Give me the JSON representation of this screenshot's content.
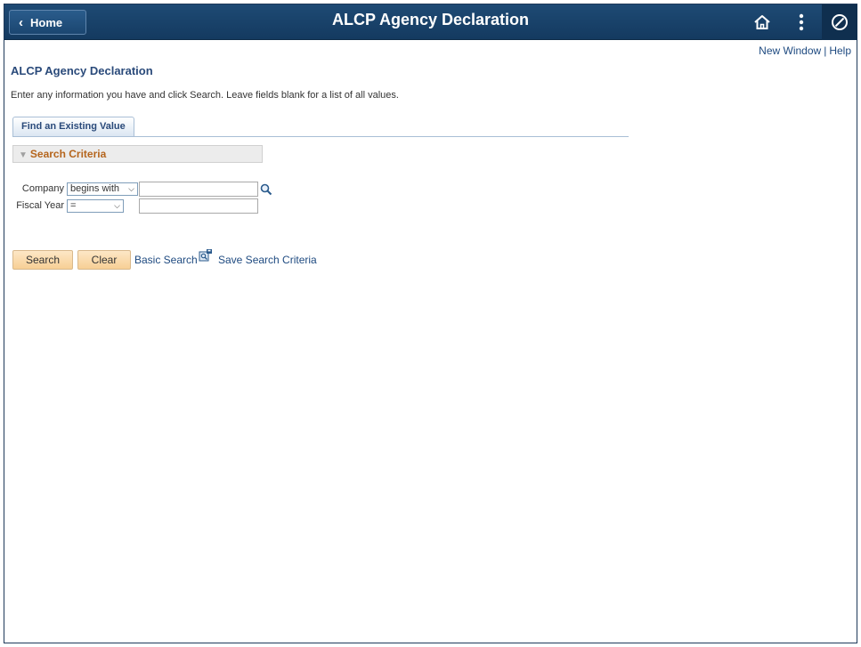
{
  "header": {
    "home_label": "Home",
    "title": "ALCP Agency Declaration",
    "icons": [
      "home-icon",
      "more-vertical-icon",
      "navigator-icon"
    ]
  },
  "toplinks": {
    "new_window": "New Window",
    "help": "Help"
  },
  "page": {
    "title": "ALCP Agency Declaration",
    "instructions": "Enter any information you have and click Search. Leave fields blank for a list of all values."
  },
  "tab": {
    "label": "Find an Existing Value"
  },
  "criteria": {
    "header": "Search Criteria",
    "fields": [
      {
        "label": "Company",
        "operator": "begins with",
        "value": ""
      },
      {
        "label": "Fiscal Year",
        "operator": "=",
        "value": ""
      }
    ]
  },
  "actions": {
    "search": "Search",
    "clear": "Clear",
    "basic_search": "Basic Search",
    "save_search": "Save Search Criteria"
  },
  "colors": {
    "banner": "#1e4a74",
    "link": "#1e4a80",
    "criteria_header_text": "#b5651d",
    "button_bg": "#fde7c6"
  }
}
